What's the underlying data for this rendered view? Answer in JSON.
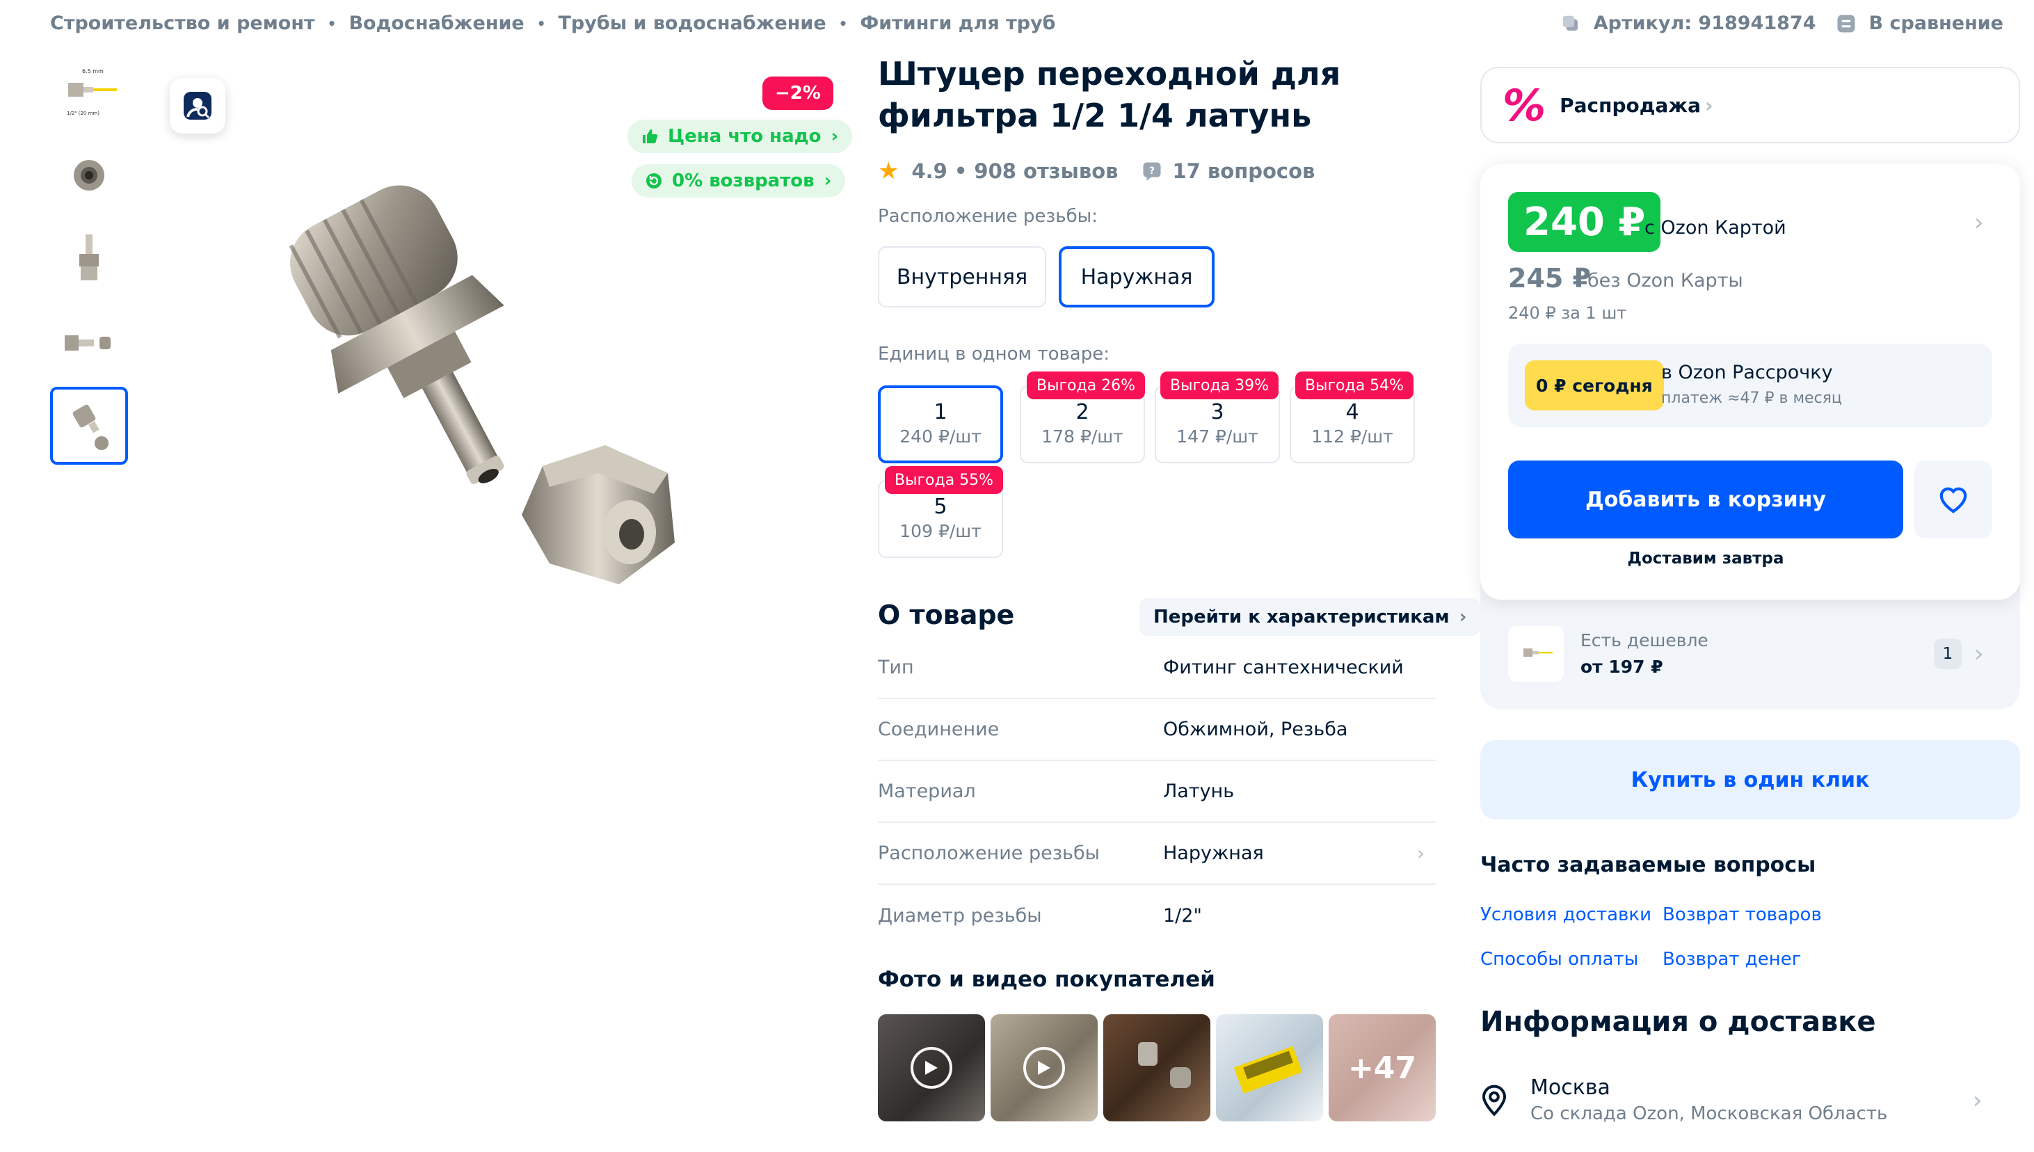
{
  "breadcrumbs": [
    "Строительство и ремонт",
    "Водоснабжение",
    "Трубы и водоснабжение",
    "Фитинги для труб"
  ],
  "header": {
    "sku": "Артикул: 918941874",
    "compare": "В сравнение"
  },
  "gallery": {
    "discount": "−2%",
    "pill_price": "Цена что надо",
    "pill_returns": "0% возвратов"
  },
  "product": {
    "title": "Штуцер переходной для фильтра 1/2 1/4 латунь",
    "rating": "4.9",
    "reviews": "908 отзывов",
    "questions": "17 вопросов"
  },
  "thread_position": {
    "label": "Расположение резьбы:",
    "options": [
      "Внутренняя",
      "Наружная"
    ],
    "selected": "Наружная"
  },
  "units": {
    "label": "Единиц в одном товаре:",
    "items": [
      {
        "count": "1",
        "price": "240 ₽/шт",
        "badge": ""
      },
      {
        "count": "2",
        "price": "178 ₽/шт",
        "badge": "Выгода 26%"
      },
      {
        "count": "3",
        "price": "147 ₽/шт",
        "badge": "Выгода 39%"
      },
      {
        "count": "4",
        "price": "112 ₽/шт",
        "badge": "Выгода 54%"
      },
      {
        "count": "5",
        "price": "109 ₽/шт",
        "badge": "Выгода 55%"
      }
    ]
  },
  "about": {
    "title": "О товаре",
    "link": "Перейти к характеристикам",
    "rows": [
      {
        "k": "Тип",
        "v": "Фитинг сантехнический"
      },
      {
        "k": "Соединение",
        "v": "Обжимной, Резьба"
      },
      {
        "k": "Материал",
        "v": "Латунь"
      },
      {
        "k": "Расположение резьбы",
        "v": "Наружная"
      },
      {
        "k": "Диаметр резьбы",
        "v": "1/2\""
      }
    ]
  },
  "photos": {
    "title": "Фото и видео покупателей",
    "more": "+47"
  },
  "sale": {
    "label": "Распродажа"
  },
  "price": {
    "card_price": "240 ₽",
    "card_label": "с Ozon Картой",
    "regular_price": "245 ₽",
    "regular_label": "без Ozon Карты",
    "per_unit": "240 ₽ за 1 шт",
    "installment_badge": "0 ₽ сегодня",
    "installment_title": "в Ozon Рассрочку",
    "installment_sub": "платеж ≈47 ₽ в месяц",
    "add_to_cart": "Добавить в корзину",
    "delivery": "Доставим завтра"
  },
  "cheaper": {
    "label": "Есть дешевле",
    "price": "от 197 ₽",
    "count": "1"
  },
  "one_click": "Купить в один клик",
  "faq": {
    "title": "Часто задаваемые вопросы",
    "links": [
      "Условия доставки",
      "Возврат товаров",
      "Способы оплаты",
      "Возврат денег"
    ]
  },
  "delivery_info": {
    "title": "Информация о доставке",
    "city": "Москва",
    "from": "Со склада Ozon, Московская Область"
  },
  "colors": {
    "accent": "#005bff",
    "discount": "#f91155",
    "green": "#10c44c",
    "yellow": "#ffdb4d"
  }
}
